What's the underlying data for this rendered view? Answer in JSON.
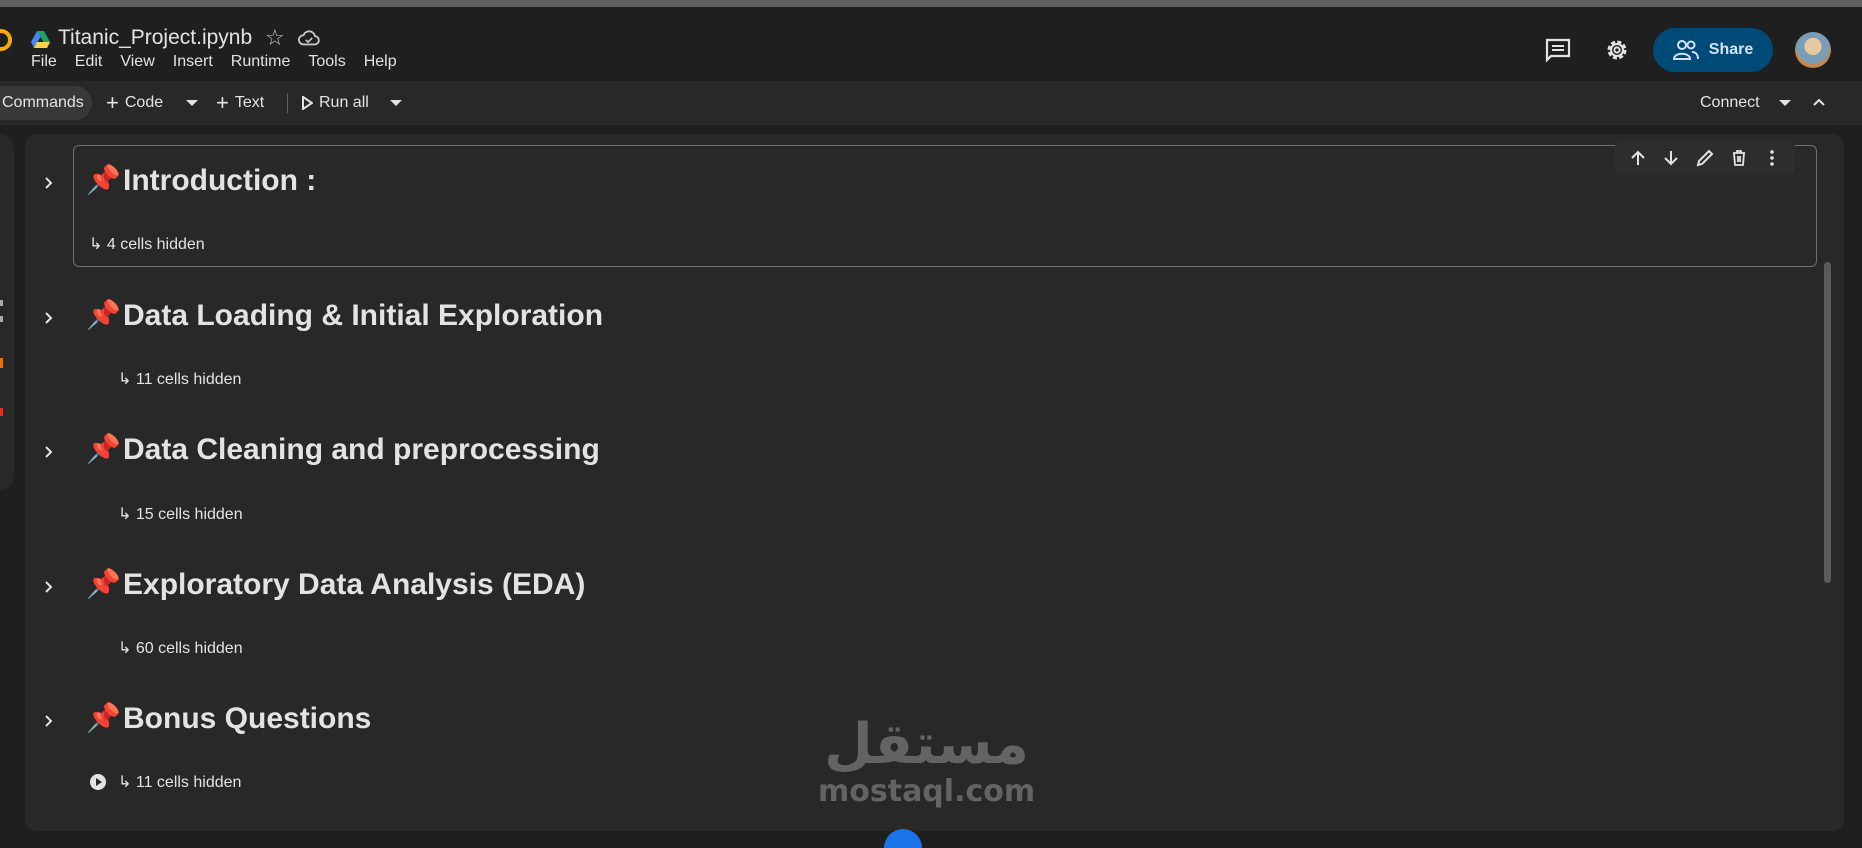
{
  "window": {
    "title": "Titanic_Project.ipynb"
  },
  "menu": [
    "File",
    "Edit",
    "View",
    "Insert",
    "Runtime",
    "Tools",
    "Help"
  ],
  "header": {
    "share_label": "Share"
  },
  "toolbar": {
    "commands_label": "Commands",
    "code_label": "Code",
    "text_label": "Text",
    "run_all_label": "Run all",
    "connect_label": "Connect"
  },
  "sections": [
    {
      "title": "Introduction :",
      "hidden": "4 cells hidden"
    },
    {
      "title": "Data Loading & Initial Exploration",
      "hidden": "11 cells hidden"
    },
    {
      "title": "Data Cleaning and preprocessing",
      "hidden": "15 cells hidden"
    },
    {
      "title": "Exploratory Data Analysis (EDA)",
      "hidden": "60 cells hidden"
    },
    {
      "title": "Bonus Questions",
      "hidden": "11 cells hidden"
    }
  ],
  "icons": {
    "section_icon": "pushpin-icon",
    "hidden_arrow": "↳"
  },
  "watermark": {
    "arabic": "مستقل",
    "latin": "mostaql.com"
  },
  "colors": {
    "accent": "#004a77",
    "background": "#1f1f1f",
    "cell": "#282828"
  }
}
